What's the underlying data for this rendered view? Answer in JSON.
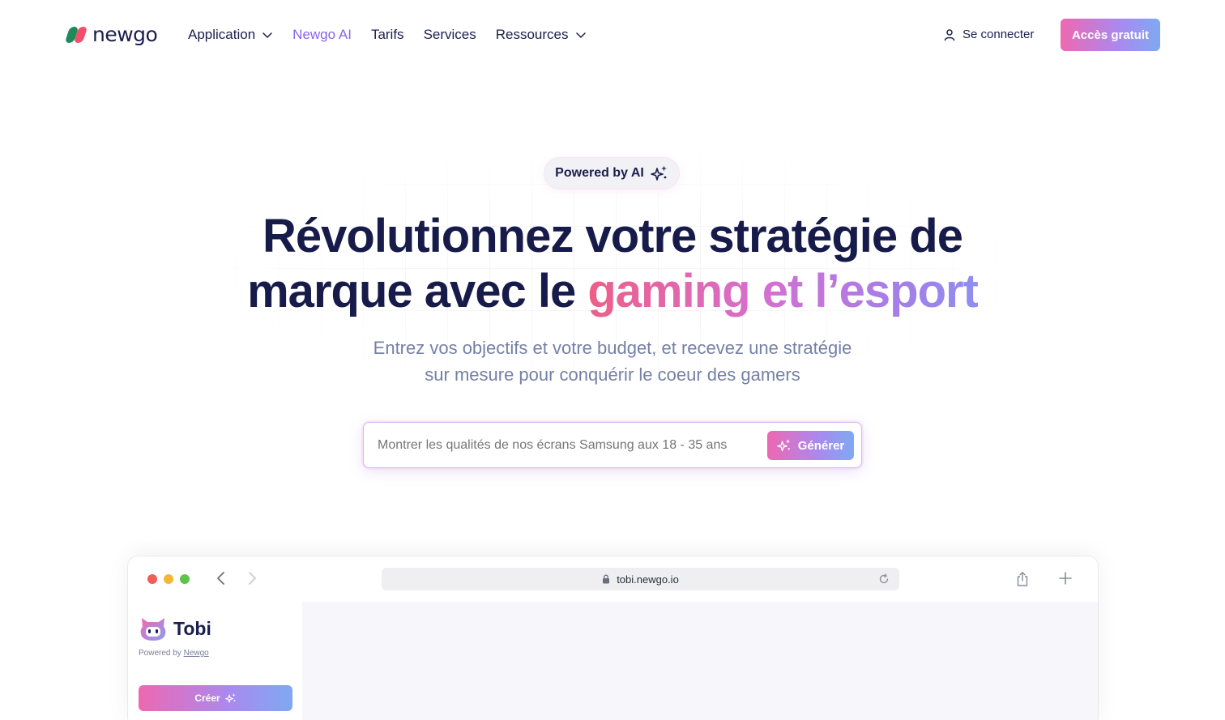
{
  "nav": {
    "logo_text": "newgo",
    "items": [
      {
        "label": "Application",
        "has_dropdown": true,
        "active": false
      },
      {
        "label": "Newgo AI",
        "has_dropdown": false,
        "active": true
      },
      {
        "label": "Tarifs",
        "has_dropdown": false,
        "active": false
      },
      {
        "label": "Services",
        "has_dropdown": false,
        "active": false
      },
      {
        "label": "Ressources",
        "has_dropdown": true,
        "active": false
      }
    ],
    "login_label": "Se connecter",
    "cta_label": "Accès gratuit"
  },
  "hero": {
    "badge": "Powered by AI",
    "headline_line1": "Révolutionnez votre stratégie de",
    "headline_line2_plain": "marque avec le ",
    "headline_line2_gradient": "gaming et l’esport",
    "sub_line1": "Entrez vos objectifs et votre budget, et recevez une stratégie",
    "sub_line2": "sur mesure pour conquérir le coeur des gamers"
  },
  "prompt": {
    "placeholder": "Montrer les qualités de nos écrans Samsung aux 18 - 35 ans",
    "button_label": "Générer"
  },
  "browser": {
    "url": "tobi.newgo.io",
    "app_name": "Tobi",
    "powered_prefix": "Powered by ",
    "powered_link": "Newgo",
    "create_label": "Créer"
  },
  "colors": {
    "navy": "#1b1f4d",
    "accent_purple": "#8a63e8",
    "gradient_start": "#ee68b1",
    "gradient_end": "#7fa9f2"
  },
  "icons": [
    "chevron-down-icon",
    "user-icon",
    "sparkles-icon",
    "lock-icon",
    "reload-icon",
    "share-icon",
    "plus-icon",
    "back-icon",
    "forward-icon",
    "robot-icon"
  ]
}
